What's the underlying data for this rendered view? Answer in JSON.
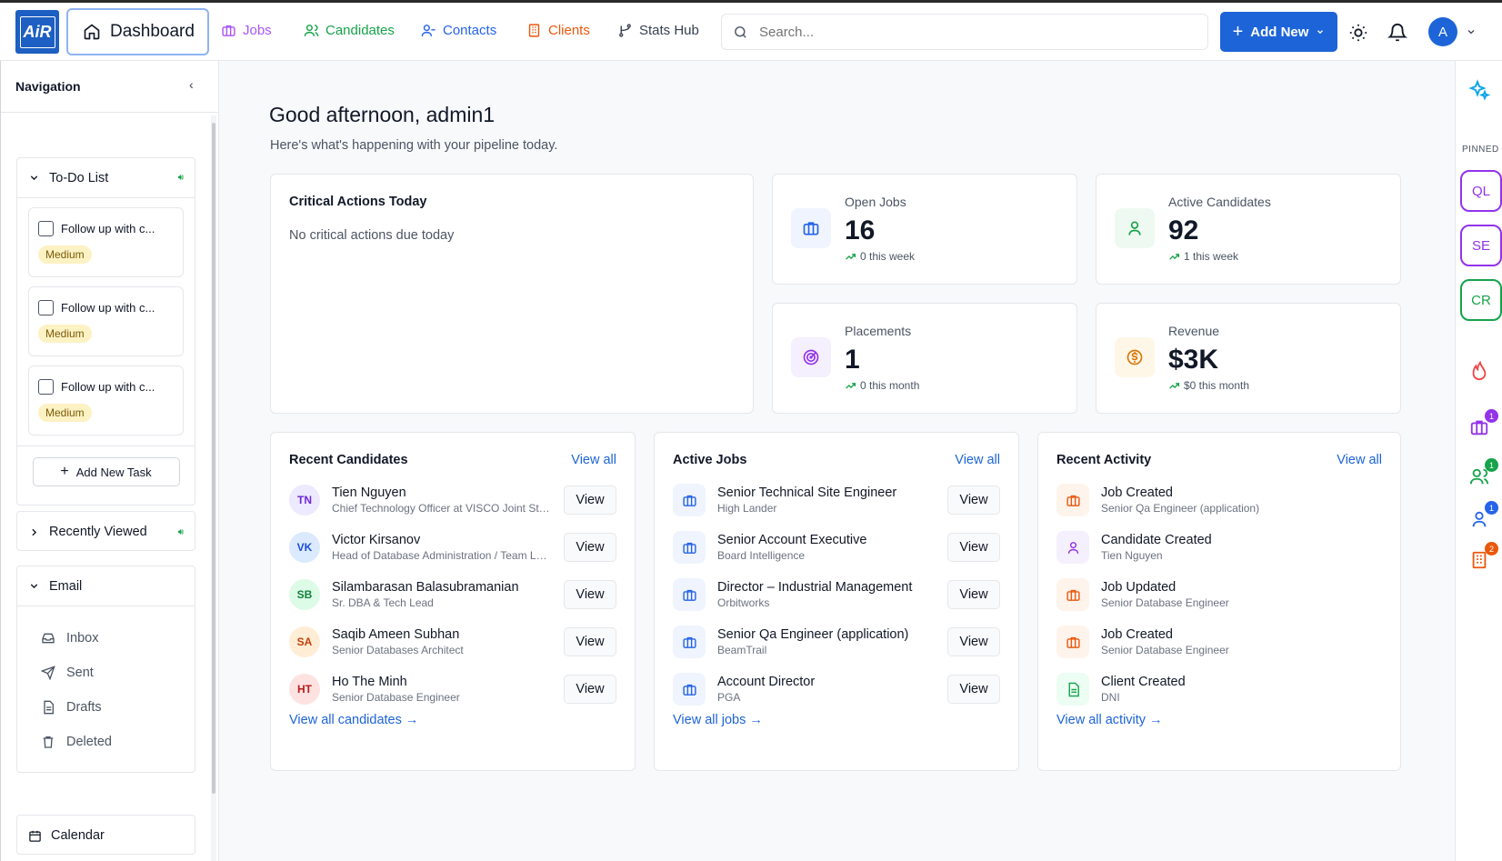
{
  "header": {
    "logo_text": "AiR",
    "dashboard_label": "Dashboard",
    "nav": [
      {
        "label": "Jobs",
        "color": "#a855f7"
      },
      {
        "label": "Candidates",
        "color": "#16a34a"
      },
      {
        "label": "Contacts",
        "color": "#2563eb"
      },
      {
        "label": "Clients",
        "color": "#ea580c"
      },
      {
        "label": "Stats Hub",
        "color": "#374151"
      }
    ],
    "search_placeholder": "Search...",
    "add_new_label": "Add New",
    "avatar_initial": "A"
  },
  "sidebar": {
    "title": "Navigation",
    "todo": {
      "title": "To-Do List",
      "items": [
        {
          "label": "Follow up with c...",
          "priority": "Medium"
        },
        {
          "label": "Follow up with c...",
          "priority": "Medium"
        },
        {
          "label": "Follow up with c...",
          "priority": "Medium"
        }
      ],
      "add_label": "Add New Task"
    },
    "recently_viewed": "Recently Viewed",
    "email": {
      "title": "Email",
      "items": [
        "Inbox",
        "Sent",
        "Drafts",
        "Deleted"
      ]
    },
    "calendar": "Calendar"
  },
  "main": {
    "greeting": "Good afternoon, admin1",
    "subtitle": "Here's what's happening with your pipeline today.",
    "critical": {
      "title": "Critical Actions Today",
      "empty": "No critical actions due today"
    },
    "stats": [
      {
        "label": "Open Jobs",
        "value": "16",
        "trend": "0 this week",
        "color": "#2563eb"
      },
      {
        "label": "Active Candidates",
        "value": "92",
        "trend": "1 this week",
        "color": "#16a34a"
      },
      {
        "label": "Placements",
        "value": "1",
        "trend": "0 this month",
        "color": "#9333ea"
      },
      {
        "label": "Revenue",
        "value": "$3K",
        "trend": "$0 this month",
        "color": "#d97706"
      }
    ],
    "recent_candidates": {
      "title": "Recent Candidates",
      "view_all": "View all",
      "footer": "View all candidates →",
      "view_label": "View",
      "items": [
        {
          "initials": "TN",
          "name": "Tien Nguyen",
          "sub": "Chief Technology Officer at VISCO Joint Stock Company"
        },
        {
          "initials": "VK",
          "name": "Victor Kirsanov",
          "sub": "Head of Database Administration / Team Lead"
        },
        {
          "initials": "SB",
          "name": "Silambarasan Balasubramanian",
          "sub": "Sr. DBA & Tech Lead"
        },
        {
          "initials": "SA",
          "name": "Saqib Ameen Subhan",
          "sub": "Senior Databases Architect"
        },
        {
          "initials": "HT",
          "name": "Ho The Minh",
          "sub": "Senior Database Engineer"
        }
      ]
    },
    "active_jobs": {
      "title": "Active Jobs",
      "view_all": "View all",
      "footer": "View all jobs →",
      "view_label": "View",
      "items": [
        {
          "name": "Senior Technical Site Engineer",
          "sub": "High Lander"
        },
        {
          "name": "Senior Account Executive",
          "sub": "Board Intelligence"
        },
        {
          "name": "Director – Industrial Management",
          "sub": "Orbitworks"
        },
        {
          "name": "Senior Qa Engineer (application)",
          "sub": "BeamTrail"
        },
        {
          "name": "Account Director",
          "sub": "PGA"
        }
      ]
    },
    "recent_activity": {
      "title": "Recent Activity",
      "view_all": "View all",
      "footer": "View all activity →",
      "items": [
        {
          "name": "Job Created",
          "sub": "Senior Qa Engineer (application)",
          "icon": "briefcase-icon"
        },
        {
          "name": "Candidate Created",
          "sub": "Tien Nguyen",
          "icon": "user-icon"
        },
        {
          "name": "Job Updated",
          "sub": "Senior Database Engineer",
          "icon": "briefcase-icon"
        },
        {
          "name": "Job Created",
          "sub": "Senior Database Engineer",
          "icon": "briefcase-icon"
        },
        {
          "name": "Client Created",
          "sub": "DNI",
          "icon": "document-icon"
        }
      ]
    }
  },
  "rail": {
    "pinned_label": "PINNED",
    "pins": [
      {
        "label": "QL",
        "color": "#9333ea"
      },
      {
        "label": "SE",
        "color": "#9333ea"
      },
      {
        "label": "CR",
        "color": "#16a34a"
      }
    ],
    "badges": [
      "1",
      "1",
      "1",
      "2"
    ]
  }
}
